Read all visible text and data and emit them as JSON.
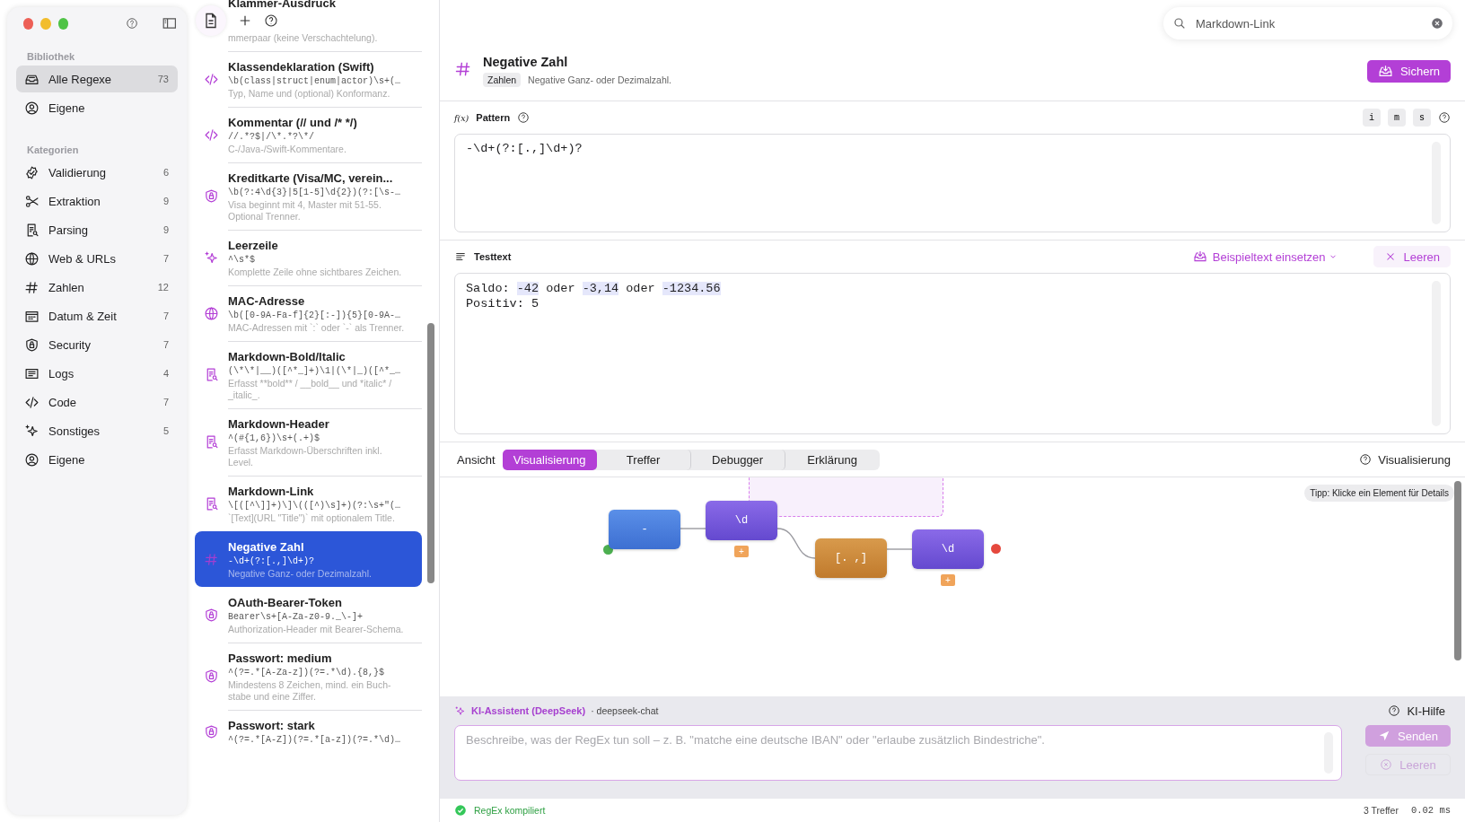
{
  "sidebar": {
    "sections": [
      {
        "title": "Bibliothek",
        "items": [
          {
            "label": "Alle Regexe",
            "count": "73",
            "selected": true
          },
          {
            "label": "Eigene",
            "selected": false
          }
        ]
      },
      {
        "title": "Kategorien",
        "items": [
          {
            "label": "Validierung",
            "count": "6",
            "selected": false
          },
          {
            "label": "Extraktion",
            "count": "9",
            "selected": false
          },
          {
            "label": "Parsing",
            "count": "9",
            "selected": false
          },
          {
            "label": "Web & URLs",
            "count": "7",
            "selected": false
          },
          {
            "label": "Zahlen",
            "count": "12",
            "selected": false
          },
          {
            "label": "Datum & Zeit",
            "count": "7",
            "selected": false
          },
          {
            "label": "Security",
            "count": "7",
            "selected": false
          },
          {
            "label": "Logs",
            "count": "4",
            "selected": false
          },
          {
            "label": "Code",
            "count": "7",
            "selected": false
          },
          {
            "label": "Sonstiges",
            "count": "5",
            "selected": false
          },
          {
            "label": "Eigene",
            "selected": false
          }
        ]
      }
    ]
  },
  "regex_list": {
    "items": [
      {
        "kind": "clipped",
        "title": "Klammer-Ausdruck",
        "description": "mmerpaar (keine Verschachtelung).",
        "selected": false
      },
      {
        "kind": "regex",
        "title": "Klassendeklaration (Swift)",
        "pattern": "\\b(class|struct|enum|actor)\\s+(…",
        "description": "Typ, Name und (optional) Konformanz.",
        "selected": false
      },
      {
        "kind": "regex",
        "title": "Kommentar (// und /* */)",
        "pattern": "//.*?$|/\\*.*?\\*/",
        "description": "C-/Java-/Swift-Kommentare.",
        "selected": false
      },
      {
        "kind": "regex",
        "title": "Kreditkarte (Visa/MC, verein...",
        "pattern": "\\b(?:4\\d{3}|5[1-5]\\d{2})(?:[\\s-…",
        "description": "Visa beginnt mit 4, Master mit 51-55. Optional Trenner.",
        "selected": false
      },
      {
        "kind": "regex",
        "title": "Leerzeile",
        "pattern": "^\\s*$",
        "description": "Komplette Zeile ohne sichtbares Zeichen.",
        "selected": false
      },
      {
        "kind": "regex",
        "title": "MAC-Adresse",
        "pattern": "\\b([0-9A-Fa-f]{2}[:-]){5}[0-9A-…",
        "description": "MAC-Adressen mit `:` oder `-` als Trenner.",
        "selected": false
      },
      {
        "kind": "regex",
        "title": "Markdown-Bold/Italic",
        "pattern": "(\\*\\*|__)([^*_]+)\\1|(\\*|_)([^*_…",
        "description": "Erfasst **bold** / __bold__ und *italic* / _italic_.",
        "selected": false
      },
      {
        "kind": "regex",
        "title": "Markdown-Header",
        "pattern": "^(#{1,6})\\s+(.+)$",
        "description": "Erfasst Markdown-Überschriften inkl. Level.",
        "selected": false
      },
      {
        "kind": "regex",
        "title": "Markdown-Link",
        "pattern": "\\[([^\\]]+)\\]\\(([^)\\s]+)(?:\\s+\"(…",
        "description": "`[Text](URL \"Title\")` mit optionalem Title.",
        "selected": false
      },
      {
        "kind": "regex",
        "title": "Negative Zahl",
        "pattern": "-\\d+(?:[.,]\\d+)?",
        "description": "Negative Ganz- oder Dezimalzahl.",
        "selected": true
      },
      {
        "kind": "regex",
        "title": "OAuth-Bearer-Token",
        "pattern": "Bearer\\s+[A-Za-z0-9._\\-]+",
        "description": "Authorization-Header mit Bearer-Schema.",
        "selected": false
      },
      {
        "kind": "regex",
        "title": "Passwort: medium",
        "pattern": "^(?=.*[A-Za-z])(?=.*\\d).{8,}$",
        "description": "Mindestens 8 Zeichen, mind. ein Buch-stabe und eine Ziffer.",
        "selected": false
      },
      {
        "kind": "regex",
        "title": "Passwort: stark",
        "pattern": "^(?=.*[A-Z])(?=.*[a-z])(?=.*\\d)…",
        "selected": false
      }
    ]
  },
  "search": {
    "value": "Markdown-Link"
  },
  "detail": {
    "name": "Negative Zahl",
    "tag": "Zahlen",
    "description": "Negative Ganz- oder Dezimalzahl.",
    "save_button": "Sichern"
  },
  "pattern": {
    "symbol": "f(x)",
    "label": "Pattern",
    "value": "-\\d+(?:[.,]\\d+)?",
    "flags": [
      "i",
      "m",
      "s"
    ]
  },
  "test_text": {
    "label": "Testtext",
    "insert_button": "Beispieltext einsetzen",
    "clear_button": "Leeren",
    "lines": [
      [
        {
          "text": "Saldo: ",
          "match": false
        },
        {
          "text": "-42",
          "match": true
        },
        {
          "text": " oder ",
          "match": false
        },
        {
          "text": "-3,14",
          "match": true
        },
        {
          "text": " oder ",
          "match": false
        },
        {
          "text": "-1234.56",
          "match": true
        }
      ],
      [
        {
          "text": "Positiv: 5",
          "match": false
        }
      ]
    ]
  },
  "view": {
    "label": "Ansicht",
    "tabs": [
      {
        "label": "Visualisierung",
        "selected": true
      },
      {
        "label": "Treffer",
        "selected": false
      },
      {
        "label": "Debugger",
        "selected": false
      },
      {
        "label": "Erklärung",
        "selected": false
      }
    ],
    "help": "Visualisierung"
  },
  "diagram": {
    "tip": "Tipp: Klicke ein Element für Details",
    "nodes": [
      {
        "kind": "literal",
        "label": "-"
      },
      {
        "kind": "class",
        "label": "\\d",
        "quantifier": "+"
      },
      {
        "kind": "set",
        "label": "[. ,]"
      },
      {
        "kind": "class",
        "label": "\\d",
        "quantifier": "+"
      }
    ]
  },
  "assistant": {
    "title": "KI-Assistent (DeepSeek)",
    "model": "· deepseek-chat",
    "help": "KI-Hilfe",
    "placeholder": "Beschreibe, was der RegEx tun soll – z. B. \"matche eine deutsche IBAN\" oder \"erlaube zusätzlich Bindestriche\".",
    "buttons": [
      {
        "kind": "send",
        "label": "Senden",
        "disabled": true
      },
      {
        "kind": "clear",
        "label": "Leeren",
        "disabled": true
      }
    ]
  },
  "status": {
    "ok": true,
    "message": "RegEx kompiliert",
    "matches": "3 Treffer",
    "time": "0.02 ms"
  }
}
